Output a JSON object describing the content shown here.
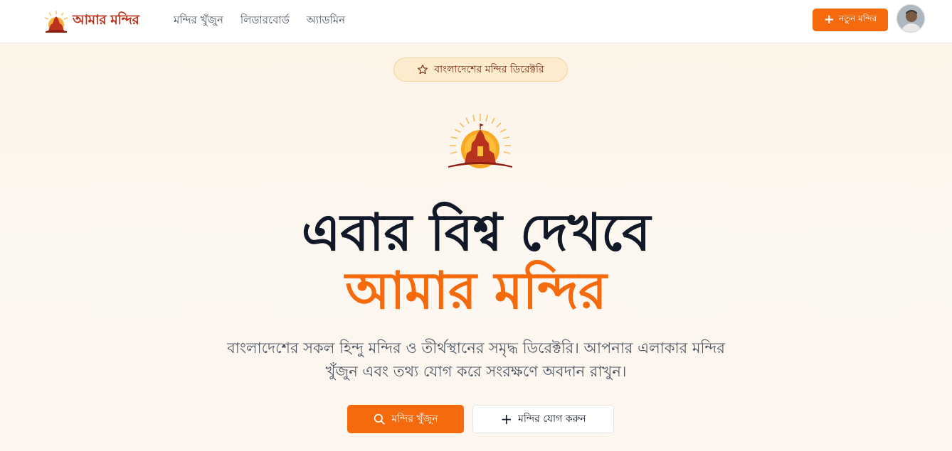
{
  "header": {
    "brand_name": "আমার মন্দির",
    "nav": [
      {
        "label": "মন্দির খুঁজুন"
      },
      {
        "label": "লিডারবোর্ড"
      },
      {
        "label": "অ্যাডমিন"
      }
    ],
    "new_button_label": "নতুন মন্দির"
  },
  "hero": {
    "badge": "বাংলাদেশের মন্দির ডিরেক্টরি",
    "title_line1": "এবার বিশ্ব দেখবে",
    "title_line2": "আমার মন্দির",
    "description": "বাংলাদেশের সকল হিন্দু মন্দির ও তীর্থস্থানের সমৃদ্ধ ডিরেক্টরি। আপনার এলাকার মন্দির খুঁজুন এবং তথ্য যোগ করে সংরক্ষণে অবদান রাখুন।",
    "primary_button": "মন্দির খুঁজুন",
    "secondary_button": "মন্দির যোগ করুন"
  },
  "colors": {
    "accent": "#f46a0c",
    "brand": "#b8321e",
    "heading": "#111827"
  },
  "icons": {
    "brand": "temple-sun-logo",
    "badge": "star-icon",
    "new_button": "plus-icon",
    "primary_button": "search-icon",
    "secondary_button": "plus-icon"
  }
}
